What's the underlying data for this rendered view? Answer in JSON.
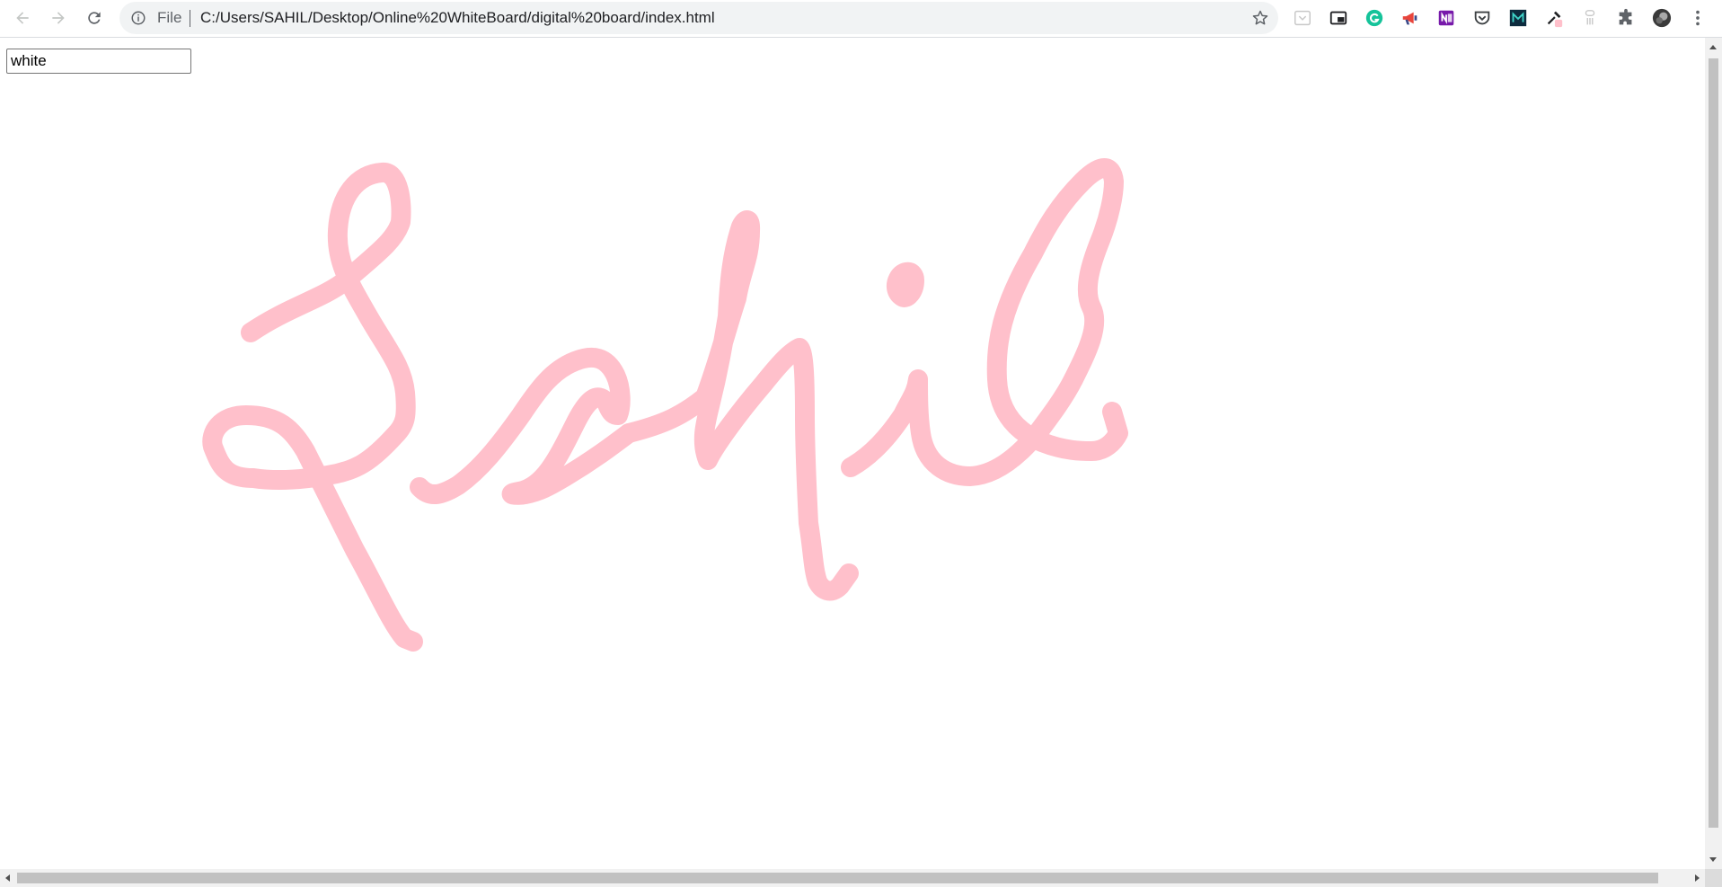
{
  "browser": {
    "address_bar": {
      "scheme_label": "File",
      "url": "C:/Users/SAHIL/Desktop/Online%20WhiteBoard/digital%20board/index.html"
    },
    "nav_icons": [
      "back-arrow-icon",
      "forward-arrow-icon",
      "reload-icon"
    ],
    "extension_icons": [
      "pocket-icon",
      "picture-in-picture-icon",
      "grammarly-icon",
      "megaphone-icon",
      "onenote-icon",
      "save-to-pocket-icon",
      "m-logo-icon",
      "eyedropper-icon",
      "keyboard-icon",
      "puzzle-extensions-icon",
      "profile-avatar-icon",
      "more-menu-icon"
    ]
  },
  "page": {
    "color_input": {
      "value": "white"
    },
    "drawing": {
      "description_text": "Sahil",
      "stroke_color": "#ffc0cb",
      "background": "#ffffff"
    }
  },
  "colors": {
    "chrome_bg": "#ffffff",
    "omnibox_bg": "#f1f3f4",
    "grammarly": "#15c39a",
    "onenote": "#7719aa"
  }
}
